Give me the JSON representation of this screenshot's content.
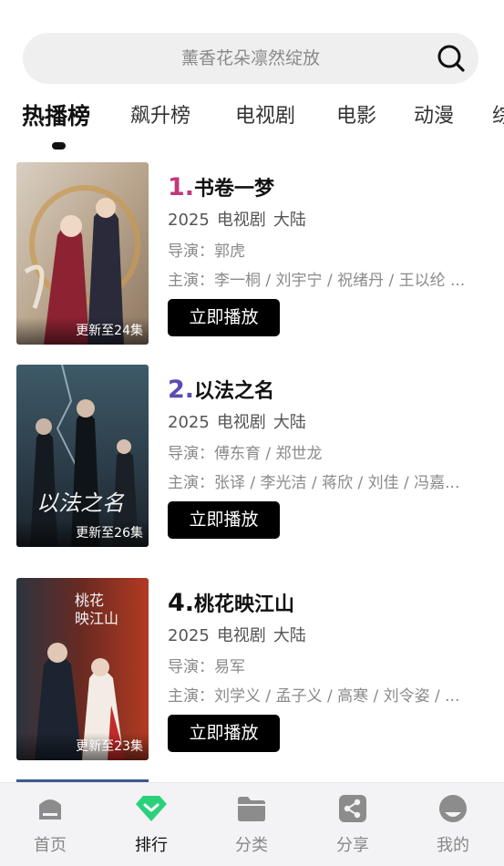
{
  "search": {
    "placeholder": "薰香花朵凛然绽放"
  },
  "tabs": [
    {
      "label": "热播榜",
      "active": true
    },
    {
      "label": "飙升榜"
    },
    {
      "label": "电视剧"
    },
    {
      "label": "电影"
    },
    {
      "label": "动漫"
    },
    {
      "label": "综"
    }
  ],
  "items": [
    {
      "rank": "1.",
      "rank_color": "#c2387a",
      "title": "书卷一梦",
      "year": "2025",
      "type": "电视剧",
      "region": "大陆",
      "director": "导演：郭虎",
      "cast": "主演：李一桐 / 刘宇宁 / 祝绪丹 / 王以纶 ...",
      "badge": "更新至24集",
      "play_label": "立即播放"
    },
    {
      "rank": "2.",
      "rank_color": "#5a4bb5",
      "title": "以法之名",
      "year": "2025",
      "type": "电视剧",
      "region": "大陆",
      "director": "导演：傅东育 / 郑世龙",
      "cast": "主演：张译 / 李光洁 / 蒋欣 / 刘佳 / 冯嘉...",
      "badge": "更新至26集",
      "play_label": "立即播放"
    },
    {
      "rank": "4.",
      "rank_color": "#111111",
      "title": "桃花映江山",
      "year": "2025",
      "type": "电视剧",
      "region": "大陆",
      "director": "导演：易军",
      "cast": "主演：刘学义 / 孟子义 / 高寒 / 刘令姿 / ...",
      "badge": "更新至23集",
      "play_label": "立即播放"
    }
  ],
  "nav": [
    {
      "label": "首页",
      "icon": "home-icon"
    },
    {
      "label": "排行",
      "icon": "ranking-icon",
      "active": true
    },
    {
      "label": "分类",
      "icon": "folder-icon"
    },
    {
      "label": "分享",
      "icon": "share-icon"
    },
    {
      "label": "我的",
      "icon": "profile-icon"
    }
  ],
  "colors": {
    "accent_green": "#2bd17a",
    "nav_gray": "#8c8c8c"
  }
}
